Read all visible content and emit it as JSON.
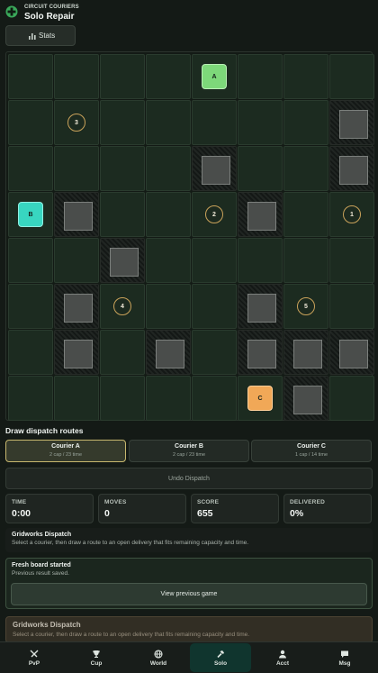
{
  "header": {
    "app_title": "CIRCUIT COURIERS",
    "screen_title": "Solo Repair"
  },
  "toolbar": {
    "stats_label": "Stats"
  },
  "board": {
    "rows": 8,
    "cols": 8,
    "walls": [
      [
        1,
        7
      ],
      [
        2,
        4
      ],
      [
        2,
        7
      ],
      [
        3,
        1
      ],
      [
        3,
        5
      ],
      [
        4,
        2
      ],
      [
        5,
        1
      ],
      [
        5,
        5
      ],
      [
        6,
        1
      ],
      [
        6,
        3
      ],
      [
        6,
        5
      ],
      [
        6,
        6
      ],
      [
        6,
        7
      ],
      [
        7,
        6
      ]
    ],
    "hubs": [
      {
        "label": "A",
        "row": 0,
        "col": 4,
        "color": "#7dd87a"
      },
      {
        "label": "B",
        "row": 3,
        "col": 0,
        "color": "#38d6c0"
      },
      {
        "label": "C",
        "row": 7,
        "col": 5,
        "color": "#f1a857"
      }
    ],
    "orders": [
      {
        "label": "3",
        "row": 1,
        "col": 1
      },
      {
        "label": "2",
        "row": 3,
        "col": 4
      },
      {
        "label": "1",
        "row": 3,
        "col": 7
      },
      {
        "label": "4",
        "row": 5,
        "col": 2
      },
      {
        "label": "5",
        "row": 5,
        "col": 6
      }
    ]
  },
  "routes": {
    "title": "Draw dispatch routes",
    "couriers": [
      {
        "name": "Courier A",
        "meta": "2 cap / 23 time"
      },
      {
        "name": "Courier B",
        "meta": "2 cap / 23 time"
      },
      {
        "name": "Courier C",
        "meta": "1 cap / 14 time"
      }
    ],
    "undo_label": "Undo Dispatch"
  },
  "stats": [
    {
      "label": "TIME",
      "value": "0:00"
    },
    {
      "label": "MOVES",
      "value": "0"
    },
    {
      "label": "SCORE",
      "value": "655"
    },
    {
      "label": "DELIVERED",
      "value": "0%"
    }
  ],
  "info": {
    "title": "Gridworks Dispatch",
    "text": "Select a courier, then draw a route to an open delivery that fits remaining capacity and time."
  },
  "result": {
    "title": "Fresh board started",
    "text": "Previous result saved.",
    "button_label": "View previous game"
  },
  "toast": {
    "title": "Gridworks Dispatch",
    "text": "Select a courier, then draw a route to an open delivery that fits remaining capacity and time."
  },
  "nav": {
    "items": [
      {
        "label": "PvP",
        "icon": "swords-icon"
      },
      {
        "label": "Cup",
        "icon": "trophy-icon"
      },
      {
        "label": "World",
        "icon": "globe-icon"
      },
      {
        "label": "Solo",
        "icon": "hammer-icon"
      },
      {
        "label": "Acct",
        "icon": "user-icon"
      },
      {
        "label": "Msg",
        "icon": "message-icon"
      }
    ]
  }
}
